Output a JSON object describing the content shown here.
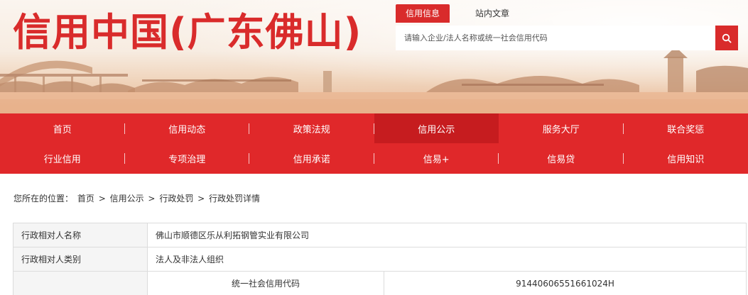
{
  "header": {
    "site_title": "信用中国(广东佛山)",
    "search_tabs": [
      {
        "label": "信用信息",
        "active": true
      },
      {
        "label": "站内文章",
        "active": false
      }
    ],
    "search": {
      "placeholder": "请输入企业/法人名称或统一社会信用代码",
      "button_icon": "search-icon"
    }
  },
  "colors": {
    "brand_red": "#d92b2b",
    "nav_red": "#e0282a",
    "nav_active": "#c61c1f"
  },
  "nav": {
    "row1": [
      {
        "label": "首页"
      },
      {
        "label": "信用动态"
      },
      {
        "label": "政策法规"
      },
      {
        "label": "信用公示",
        "active": true
      },
      {
        "label": "服务大厅"
      },
      {
        "label": "联合奖惩"
      }
    ],
    "row2": [
      {
        "label": "行业信用"
      },
      {
        "label": "专项治理"
      },
      {
        "label": "信用承诺"
      },
      {
        "label": "信易+"
      },
      {
        "label": "信易贷"
      },
      {
        "label": "信用知识"
      }
    ]
  },
  "breadcrumb": {
    "prefix": "您所在的位置：",
    "items": [
      "首页",
      "信用公示",
      "行政处罚",
      "行政处罚详情"
    ],
    "separator": ">"
  },
  "detail": {
    "rows": [
      {
        "label": "行政相对人名称",
        "value": "佛山市顺德区乐从利拓钢管实业有限公司"
      },
      {
        "label": "行政相对人类别",
        "value": "法人及非法人组织"
      }
    ],
    "sub_row": {
      "label": "统一社会信用代码",
      "value": "91440606551661024H"
    }
  }
}
